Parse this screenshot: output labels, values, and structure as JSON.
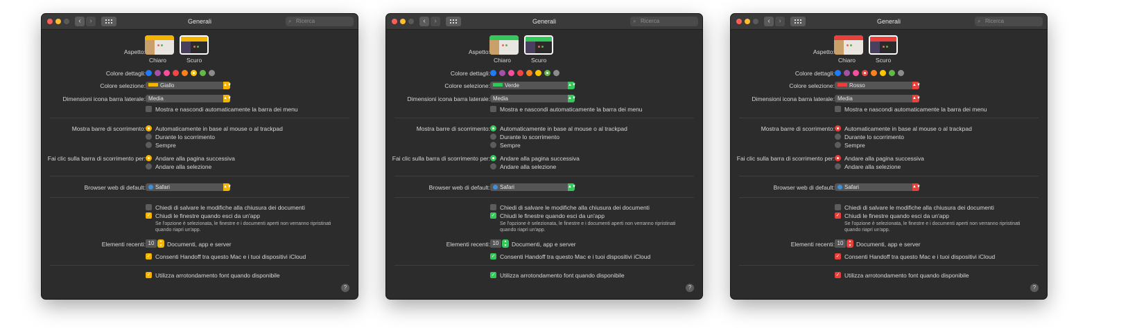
{
  "windows": [
    {
      "accent": "#f5b400",
      "selection": {
        "label": "Giallo",
        "color": "#f5b400"
      },
      "selected_swatch": 5,
      "radio_fill": "#f5b400"
    },
    {
      "accent": "#34c759",
      "selection": {
        "label": "Verde",
        "color": "#34c759"
      },
      "selected_swatch": 6,
      "radio_fill": "#34c759"
    },
    {
      "accent": "#e8403b",
      "selection": {
        "label": "Rosso",
        "color": "#e8403b"
      },
      "selected_swatch": 3,
      "radio_fill": "#e8403b"
    }
  ],
  "common": {
    "title": "Generali",
    "search_placeholder": "Ricerca",
    "nav_back": "‹",
    "nav_forward": "›",
    "appearance_label": "Aspetto:",
    "appearance_light": "Chiaro",
    "appearance_dark": "Scuro",
    "accent_label": "Colore dettagli:",
    "selection_label": "Colore selezione:",
    "sidebar_icon_label": "Dimensioni icona barra laterale:",
    "sidebar_icon_value": "Media",
    "menu_bar_auto": "Mostra e nascondi automaticamente la barra dei menu",
    "scrollbars_label": "Mostra barre di scorrimento:",
    "scrollbars_options": [
      "Automaticamente in base al mouse o al trackpad",
      "Durante lo scorrimento",
      "Sempre"
    ],
    "click_scroll_label": "Fai clic sulla barra di scorrimento per:",
    "click_scroll_options": [
      "Andare alla pagina successiva",
      "Andare alla selezione"
    ],
    "browser_label": "Browser web di default:",
    "browser_value": "Safari",
    "ask_save": "Chiedi di salvare le modifiche alla chiusura dei documenti",
    "close_windows": "Chiudi le finestre quando esci da un'app",
    "close_windows_note_1": "Se l'opzione è selezionata, le finestre e i documenti aperti non verranno ripristinati",
    "close_windows_note_2": "quando riapri un'app.",
    "recent_label": "Elementi recenti:",
    "recent_value": "10",
    "recent_suffix": "Documenti, app e server",
    "handoff": "Consenti Handoff tra questo Mac e i tuoi dispositivi iCloud",
    "font_smoothing": "Utilizza arrotondamento font quando disponibile",
    "help": "?"
  },
  "swatch_colors": [
    "#1f7cf6",
    "#a550a7",
    "#f74f9e",
    "#f34545",
    "#f7821b",
    "#ffc600",
    "#62ba46",
    "#8c8c8c"
  ],
  "swatch_names": [
    "blue",
    "purple",
    "pink",
    "red",
    "orange",
    "yellow",
    "green",
    "graphite"
  ]
}
